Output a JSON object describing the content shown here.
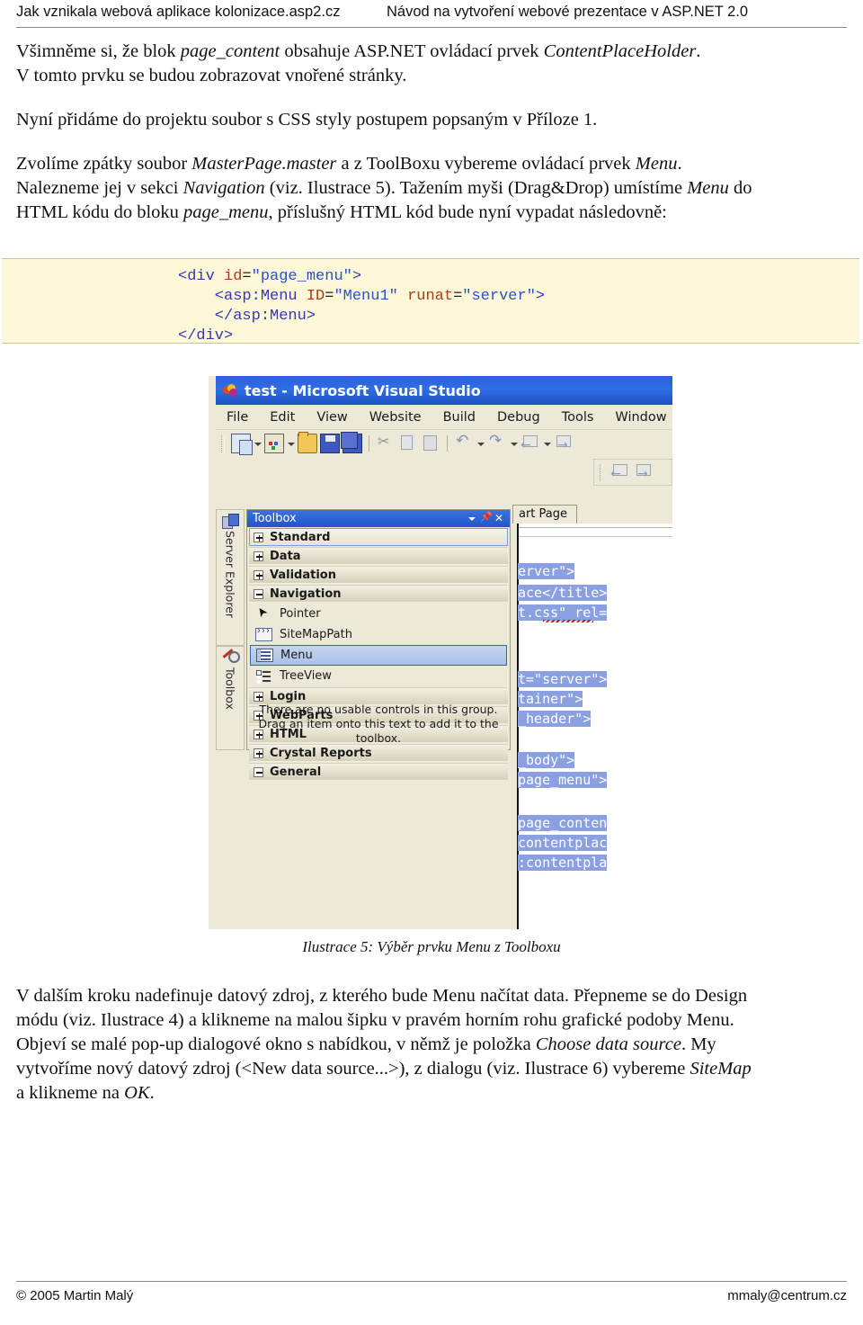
{
  "header": {
    "left": "Jak vznikala webová aplikace kolonizace.asp2.cz",
    "right": "Návod na vytvoření webové prezentace v ASP.NET 2.0"
  },
  "body": {
    "p1_a": "Všimněme si, že blok ",
    "p1_b": "page_content",
    "p1_c": " obsahuje ASP.NET ovládací prvek ",
    "p1_d": "ContentPlaceHolder",
    "p1_e": ".",
    "p2": "V tomto prvku se budou zobrazovat vnořené stránky.",
    "p3": "Nyní přidáme do projektu soubor s CSS styly postupem popsaným v Příloze 1.",
    "p4_a": "Zvolíme zpátky soubor ",
    "p4_b": "MasterPage.master",
    "p4_c": " a z ToolBoxu vybereme ovládací prvek ",
    "p4_d": "Menu",
    "p4_e": ".",
    "p5_a": "Nalezneme jej v sekci ",
    "p5_b": "Navigation",
    "p5_c": " (viz. Ilustrace 5). Tažením myši (Drag&Drop) umístíme ",
    "p5_d": "Menu",
    "p5_e": " do",
    "p6_a": "HTML kódu do bloku ",
    "p6_b": "page_menu",
    "p6_c": ", příslušný HTML kód bude nyní vypadat následovně:",
    "p7_a": "V dalším kroku nadefinuje datový zdroj, z kterého bude Menu načítat data. Přepneme se do Design",
    "p7_b": "módu (viz. Ilustrace 4) a klikneme na malou šipku v pravém horním rohu grafické podoby Menu.",
    "p8_a": "Objeví se malé pop-up dialogové okno s nabídkou, v němž je položka ",
    "p8_b": "Choose data source",
    "p8_c": ". My",
    "p9_a": "vytvoříme nový datový zdroj (<New data source...>), z dialogu (viz. Ilustrace 6) vybereme ",
    "p9_b": "SiteMap",
    "p10": "a klikneme na ",
    "p10_b": "OK",
    "p10_c": "."
  },
  "code_block": {
    "line1_tag_open": "<div ",
    "line1_attr": "id",
    "line1_eq": "=",
    "line1_val": "\"page_menu\"",
    "line1_close": ">",
    "line2_tag_open": "    <asp:Menu ",
    "line2_attr1": "ID",
    "line2_val1": "\"Menu1\"",
    "line2_attr2": "runat",
    "line2_val2": "\"server\"",
    "line2_close": ">",
    "line3": "    </asp:Menu>",
    "line4": "</div>"
  },
  "vs": {
    "title": "test - Microsoft Visual Studio",
    "menu_items": [
      "File",
      "Edit",
      "View",
      "Website",
      "Build",
      "Debug",
      "Tools",
      "Window"
    ],
    "dock_tabs": [
      {
        "label": "Server Explorer",
        "icon": "server-explorer-icon"
      },
      {
        "label": "Toolbox",
        "icon": "toolbox-icon"
      }
    ],
    "toolbox": {
      "title": "Toolbox",
      "groups": [
        {
          "label": "Standard",
          "state": "collapsed"
        },
        {
          "label": "Data",
          "state": "collapsed"
        },
        {
          "label": "Validation",
          "state": "collapsed"
        },
        {
          "label": "Navigation",
          "state": "expanded"
        }
      ],
      "items": [
        {
          "label": "Pointer",
          "icon": "pointer-icon",
          "selected": false
        },
        {
          "label": "SiteMapPath",
          "icon": "sitemappath-icon",
          "selected": false
        },
        {
          "label": "Menu",
          "icon": "menu-control-icon",
          "selected": true
        },
        {
          "label": "TreeView",
          "icon": "treeview-icon",
          "selected": false
        }
      ],
      "groups_after": [
        {
          "label": "Login",
          "state": "collapsed"
        },
        {
          "label": "WebParts",
          "state": "collapsed"
        },
        {
          "label": "HTML",
          "state": "collapsed"
        },
        {
          "label": "Crystal Reports",
          "state": "collapsed"
        },
        {
          "label": "General",
          "state": "expanded"
        }
      ],
      "empty_line1": "There are no usable controls in this group.",
      "empty_line2": "Drag an item onto this text to add it to the",
      "empty_line3": "toolbox."
    },
    "editor": {
      "tab_label": "art Page",
      "lines": [
        "erver\">",
        "ace</title>",
        "t.css\" rel=",
        "t=\"server\">",
        "tainer\">",
        "_header\">",
        "_body\">",
        "page_menu\">",
        "page_conten",
        "contentplac",
        ":contentpla"
      ]
    }
  },
  "caption": "Ilustrace 5: Výběr prvku Menu z Toolboxu",
  "footer": {
    "left": "© 2005 Martin Malý",
    "right": "mmaly@centrum.cz"
  },
  "colors": {
    "code_bg": "#fdf9d8",
    "vs_title_blue": "#2f6ee6",
    "vs_chrome": "#ece9d8",
    "selection_blue": "#8aa0e0",
    "toolbox_selected": "#a9c0e8"
  }
}
